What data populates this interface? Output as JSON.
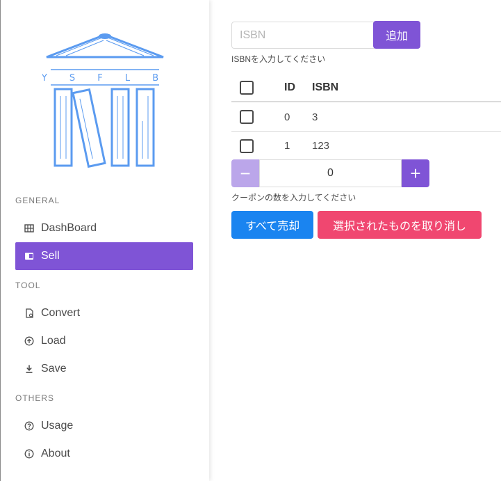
{
  "sidebar": {
    "logo_text": "Y S F L B",
    "sections": [
      {
        "label": "GENERAL",
        "items": [
          {
            "label": "DashBoard",
            "icon": "dashboard-icon",
            "active": false
          },
          {
            "label": "Sell",
            "icon": "book-icon",
            "active": true
          }
        ]
      },
      {
        "label": "TOOL",
        "items": [
          {
            "label": "Convert",
            "icon": "file-convert-icon",
            "active": false
          },
          {
            "label": "Load",
            "icon": "upload-icon",
            "active": false
          },
          {
            "label": "Save",
            "icon": "download-icon",
            "active": false
          }
        ]
      },
      {
        "label": "OTHERS",
        "items": [
          {
            "label": "Usage",
            "icon": "help-icon",
            "active": false
          },
          {
            "label": "About",
            "icon": "info-icon",
            "active": false
          }
        ]
      }
    ]
  },
  "isbn": {
    "placeholder": "ISBN",
    "value": "",
    "add_label": "追加",
    "help": "ISBNを入力してください"
  },
  "table": {
    "columns": [
      "ID",
      "ISBN"
    ],
    "rows": [
      {
        "id": "0",
        "isbn": "3",
        "checked": false
      },
      {
        "id": "1",
        "isbn": "123",
        "checked": false
      }
    ]
  },
  "coupon": {
    "value": "0",
    "minus": "−",
    "plus": "+",
    "help": "クーポンの数を入力してください"
  },
  "actions": {
    "sell_all_label": "すべて売却",
    "cancel_selected_label": "選択されたものを取り消し"
  },
  "colors": {
    "primary": "#7f54d6",
    "primary_light": "#bba6ea",
    "info": "#1a84f0",
    "danger": "#f04770",
    "logo": "#5b9bf0"
  }
}
